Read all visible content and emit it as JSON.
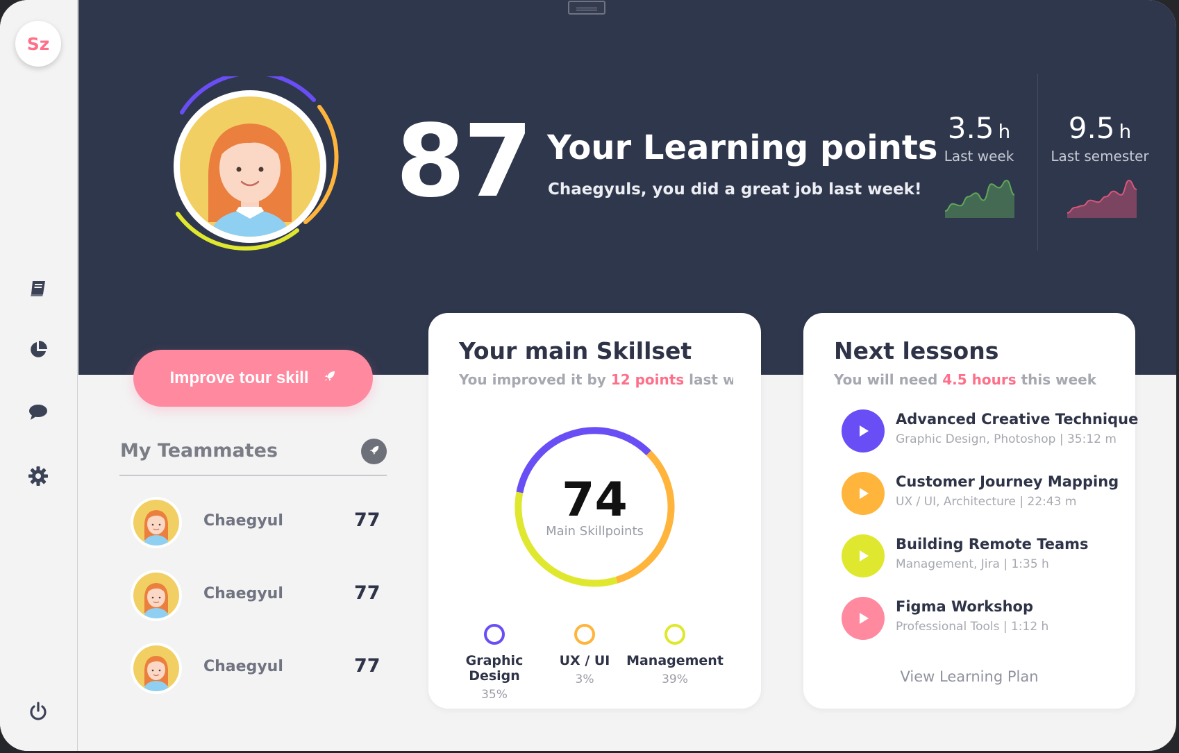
{
  "app": {
    "logo_text": "Sz",
    "colors": {
      "navy": "#2f374d",
      "pink": "#ff8aa0",
      "purple": "#6a4ef5",
      "orange": "#ffb43c",
      "lime": "#dfe82e"
    }
  },
  "sidebar": {
    "items": [
      {
        "icon": "book-icon"
      },
      {
        "icon": "pie-chart-icon"
      },
      {
        "icon": "chat-icon"
      },
      {
        "icon": "gear-icon"
      }
    ],
    "bottom_icon": "power-icon"
  },
  "hero": {
    "score": "87",
    "title": "Your Learning points",
    "subtitle": "Chaegyuls, you did a great job last week!",
    "stats": [
      {
        "value": "3.5",
        "unit": "h",
        "label": "Last week",
        "color": "#5fa85b",
        "trend": [
          0.15,
          0.35,
          0.3,
          0.55,
          0.65,
          0.45,
          0.9,
          0.8,
          1.0,
          0.6
        ]
      },
      {
        "value": "9.5",
        "unit": "h",
        "label": "Last semester",
        "color": "#d9577a",
        "trend": [
          0.1,
          0.25,
          0.3,
          0.45,
          0.4,
          0.55,
          0.7,
          0.6,
          1.0,
          0.75
        ]
      }
    ]
  },
  "improve_button": {
    "label": "Improve tour skill"
  },
  "teammates": {
    "title": "My Teammates",
    "members": [
      {
        "name": "Chaegyul",
        "points": "77"
      },
      {
        "name": "Chaegyul",
        "points": "77"
      },
      {
        "name": "Chaegyul",
        "points": "77"
      }
    ]
  },
  "skillset": {
    "title": "Your main Skillset",
    "subtitle_pre": "You improved it by ",
    "subtitle_hl": "12 points",
    "subtitle_post": " last week",
    "center_value": "74",
    "center_label": "Main Skillpoints",
    "segments": [
      {
        "name": "Graphic Design",
        "percent": "35%",
        "color": "#6a4ef5"
      },
      {
        "name": "UX / UI",
        "percent": "3%",
        "color": "#ffb43c"
      },
      {
        "name": "Management",
        "percent": "39%",
        "color": "#dfe82e"
      }
    ]
  },
  "lessons": {
    "title": "Next lessons",
    "subtitle_pre": "You will need ",
    "subtitle_hl": "4.5 hours",
    "subtitle_post": " this week",
    "items": [
      {
        "title": "Advanced Creative Technique",
        "meta": "Graphic Design, Photoshop | 35:12 m",
        "color": "#6a4ef5"
      },
      {
        "title": "Customer Journey Mapping",
        "meta": "UX / UI, Architecture | 22:43 m",
        "color": "#ffb43c"
      },
      {
        "title": "Building Remote Teams",
        "meta": "Management, Jira | 1:35 h",
        "color": "#dfe82e"
      },
      {
        "title": "Figma Workshop",
        "meta": "Professional Tools | 1:12 h",
        "color": "#ff8aa0"
      }
    ],
    "link": "View Learning Plan"
  }
}
